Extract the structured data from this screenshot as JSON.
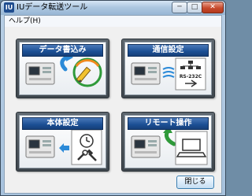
{
  "window": {
    "title": "IUデータ転送ツール",
    "app_icon_text": "IU",
    "close_glyph": "✕",
    "min_glyph": "─",
    "max_glyph": "□"
  },
  "menu": {
    "help_label": "ヘルプ(H)"
  },
  "tiles": [
    {
      "label": "データ書込み",
      "icon": "pencil-write-icon"
    },
    {
      "label": "通信設定",
      "icon": "network-serial-usb-icon",
      "port_label": "RS-232C"
    },
    {
      "label": "本体設定",
      "icon": "clock-tools-icon"
    },
    {
      "label": "リモート操作",
      "icon": "laptop-icon"
    }
  ],
  "close_button": {
    "label": "閉じる"
  },
  "colors": {
    "header_blue": "#1b4f94",
    "tile_frame": "#4b545b",
    "accent_green": "#2f9a3a",
    "accent_blue": "#2b8ad8"
  }
}
